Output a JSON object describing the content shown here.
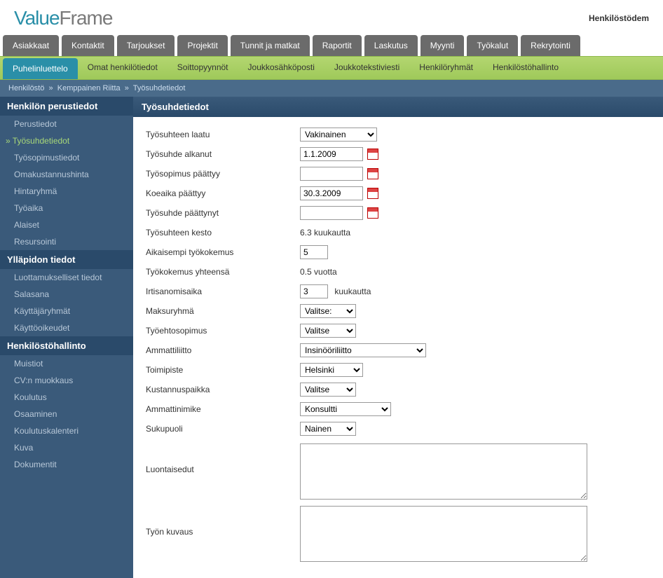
{
  "header": {
    "right_text": "Henkilöstödem"
  },
  "main_nav": [
    "Asiakkaat",
    "Kontaktit",
    "Tarjoukset",
    "Projektit",
    "Tunnit ja matkat",
    "Raportit",
    "Laskutus",
    "Myynti",
    "Työkalut",
    "Rekrytointi"
  ],
  "sub_nav": {
    "items": [
      "Puhelinluettelo",
      "Omat henkilötiedot",
      "Soittopyynnöt",
      "Joukkosähköposti",
      "Joukkotekstiviesti",
      "Henkilöryhmät",
      "Henkilöstöhallinto"
    ],
    "active_index": 0
  },
  "breadcrumb": {
    "a": "Henkilöstö",
    "sep": "»",
    "b": "Kemppainen Riitta",
    "c": "Työsuhdetiedot"
  },
  "sidebar": {
    "sections": [
      {
        "title": "Henkilön perustiedot",
        "items": [
          "Perustiedot",
          "Työsuhdetiedot",
          "Työsopimustiedot",
          "Omakustannushinta",
          "Hintaryhmä",
          "Työaika",
          "Alaiset",
          "Resursointi"
        ],
        "active_index": 1
      },
      {
        "title": "Ylläpidon tiedot",
        "items": [
          "Luottamukselliset tiedot",
          "Salasana",
          "Käyttäjäryhmät",
          "Käyttöoikeudet"
        ],
        "active_index": -1
      },
      {
        "title": "Henkilöstöhallinto",
        "items": [
          "Muistiot",
          "CV:n muokkaus",
          "Koulutus",
          "Osaaminen",
          "Koulutuskalenteri",
          "Kuva",
          "Dokumentit"
        ],
        "active_index": -1
      }
    ]
  },
  "panel": {
    "title": "Työsuhdetiedot"
  },
  "form": {
    "tyosuhteen_laatu": {
      "label": "Työsuhteen laatu",
      "value": "Vakinainen"
    },
    "tyosuhde_alkanut": {
      "label": "Työsuhde alkanut",
      "value": "1.1.2009"
    },
    "tyosopimus_paattyy": {
      "label": "Työsopimus päättyy",
      "value": ""
    },
    "koeaika_paattyy": {
      "label": "Koeaika päättyy",
      "value": "30.3.2009"
    },
    "tyosuhde_paattynyt": {
      "label": "Työsuhde päättynyt",
      "value": ""
    },
    "tyosuhteen_kesto": {
      "label": "Työsuhteen kesto",
      "value": "6.3 kuukautta"
    },
    "aikaisempi_tyokokemus": {
      "label": "Aikaisempi työkokemus",
      "value": "5"
    },
    "tyokokemus_yhteensa": {
      "label": "Työkokemus yhteensä",
      "value": "0.5 vuotta"
    },
    "irtisanomisaika": {
      "label": "Irtisanomisaika",
      "value": "3",
      "suffix": "kuukautta"
    },
    "maksuryhma": {
      "label": "Maksuryhmä",
      "value": "Valitse:"
    },
    "tyoehtosopimus": {
      "label": "Työehtosopimus",
      "value": "Valitse"
    },
    "ammattiliitto": {
      "label": "Ammattiliitto",
      "value": "Insinööriliitto"
    },
    "toimipiste": {
      "label": "Toimipiste",
      "value": "Helsinki"
    },
    "kustannuspaikka": {
      "label": "Kustannuspaikka",
      "value": "Valitse"
    },
    "ammattinimike": {
      "label": "Ammattinimike",
      "value": "Konsultti"
    },
    "sukupuoli": {
      "label": "Sukupuoli",
      "value": "Nainen"
    },
    "luontaisedut": {
      "label": "Luontaisedut",
      "value": ""
    },
    "tyon_kuvaus": {
      "label": "Työn kuvaus",
      "value": ""
    }
  }
}
